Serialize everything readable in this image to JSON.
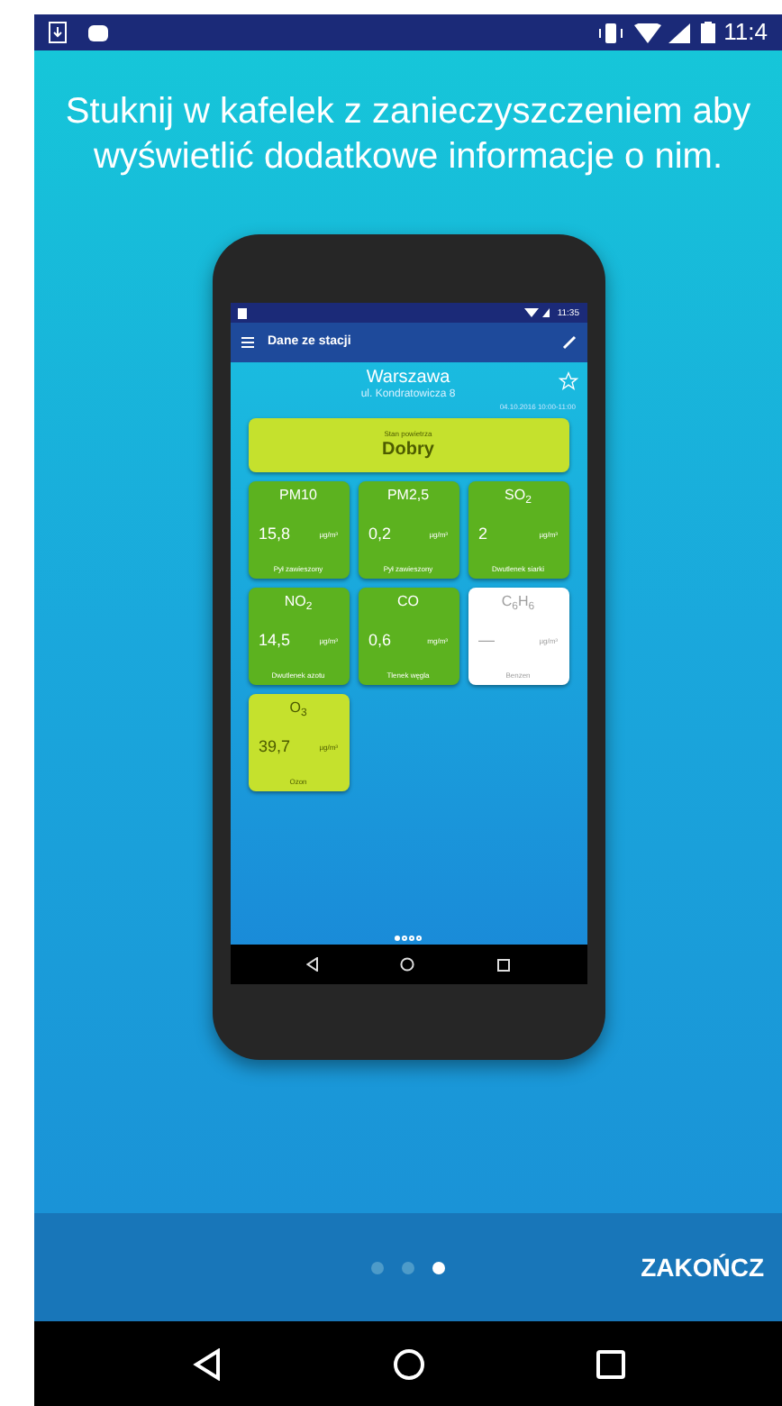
{
  "status_bar": {
    "time": "11:4"
  },
  "instruction": "Stuknij w kafelek z zanieczyszczeniem aby wyświetlić dodatkowe informacje o nim.",
  "phone": {
    "status_bar": {
      "time": "11:35"
    },
    "app_bar": {
      "title": "Dane ze stacji"
    },
    "station": {
      "city": "Warszawa",
      "address": "ul. Kondratowicza 8",
      "date": "04.10.2016 10:00-11:00",
      "favorite": false
    },
    "air_quality": {
      "label": "Stan powietrza",
      "value": "Dobry",
      "color": "#c5e12d"
    },
    "tiles": [
      {
        "name": "PM10",
        "value": "15,8",
        "unit": "µg/m³",
        "description": "Pył zawieszony",
        "color": "#5cb21f"
      },
      {
        "name": "PM2,5",
        "value": "0,2",
        "unit": "µg/m³",
        "description": "Pył zawieszony",
        "color": "#5cb21f"
      },
      {
        "name": "SO$_{2}$",
        "value": "2",
        "unit": "µg/m³",
        "description": "Dwutlenek siarki",
        "color": "#5cb21f"
      },
      {
        "name": "NO$_{2}$",
        "value": "14,5",
        "unit": "µg/m³",
        "description": "Dwutlenek azotu",
        "color": "#5cb21f"
      },
      {
        "name": "CO",
        "value": "0,6",
        "unit": "mg/m³",
        "description": "Tlenek węgla",
        "color": "#5cb21f"
      },
      {
        "name": "C$_{6}$H$_{6}$",
        "value": "—",
        "unit": "µg/m³",
        "description": "Benzen",
        "color": "#ffffff"
      },
      {
        "name": "O$_{3}$",
        "value": "39,7",
        "unit": "µg/m³",
        "description": "Ozon",
        "color": "#c5e12d"
      }
    ],
    "pager_dots": [
      {
        "selected": true
      },
      {
        "selected": false
      },
      {
        "selected": false
      },
      {
        "selected": false
      }
    ]
  },
  "pager": {
    "dots": [
      {
        "selected": false
      },
      {
        "selected": false
      },
      {
        "selected": true
      }
    ]
  },
  "finish_button": "ZAKOŃCZ"
}
